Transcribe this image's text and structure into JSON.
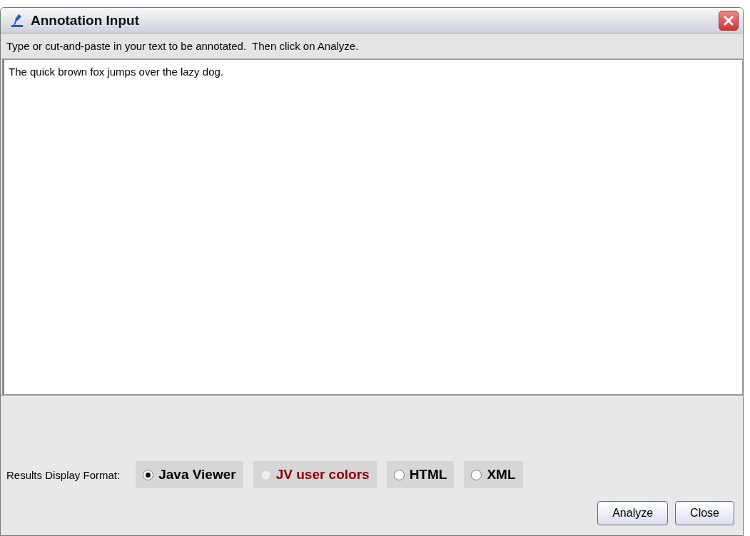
{
  "window": {
    "title": "Annotation Input"
  },
  "instructions": "Type or cut-and-paste in your text to be annotated.  Then click on Analyze.",
  "text_area": {
    "value": "The quick brown fox jumps over the lazy dog."
  },
  "format": {
    "label": "Results Display Format:",
    "options": [
      {
        "label": "Java Viewer",
        "selected": true,
        "disabled": false,
        "color": "#000000"
      },
      {
        "label": "JV user colors",
        "selected": false,
        "disabled": true,
        "color": "#8b0000"
      },
      {
        "label": "HTML",
        "selected": false,
        "disabled": false,
        "color": "#000000"
      },
      {
        "label": "XML",
        "selected": false,
        "disabled": false,
        "color": "#000000"
      }
    ]
  },
  "buttons": [
    "Analyze",
    "Close"
  ]
}
